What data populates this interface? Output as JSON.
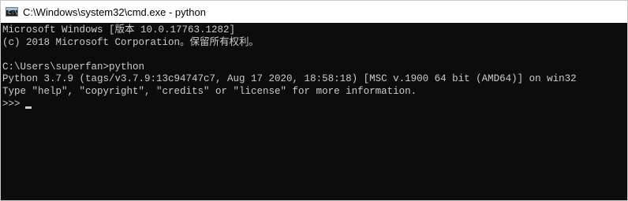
{
  "window": {
    "title": "C:\\Windows\\system32\\cmd.exe - python",
    "icon": "cmd-icon",
    "icon_glyph": "C:\\",
    "colors": {
      "console_background": "#0c0c0c",
      "console_text": "#cccccc",
      "titlebar_background": "#ffffff"
    }
  },
  "console": {
    "lines": [
      "Microsoft Windows [版本 10.0.17763.1282]",
      "(c) 2018 Microsoft Corporation。保留所有权利。",
      "",
      "C:\\Users\\superfan>python",
      "Python 3.7.9 (tags/v3.7.9:13c94747c7, Aug 17 2020, 18:58:18) [MSC v.1900 64 bit (AMD64)] on win32",
      "Type \"help\", \"copyright\", \"credits\" or \"license\" for more information."
    ],
    "prompt": ">>>"
  }
}
